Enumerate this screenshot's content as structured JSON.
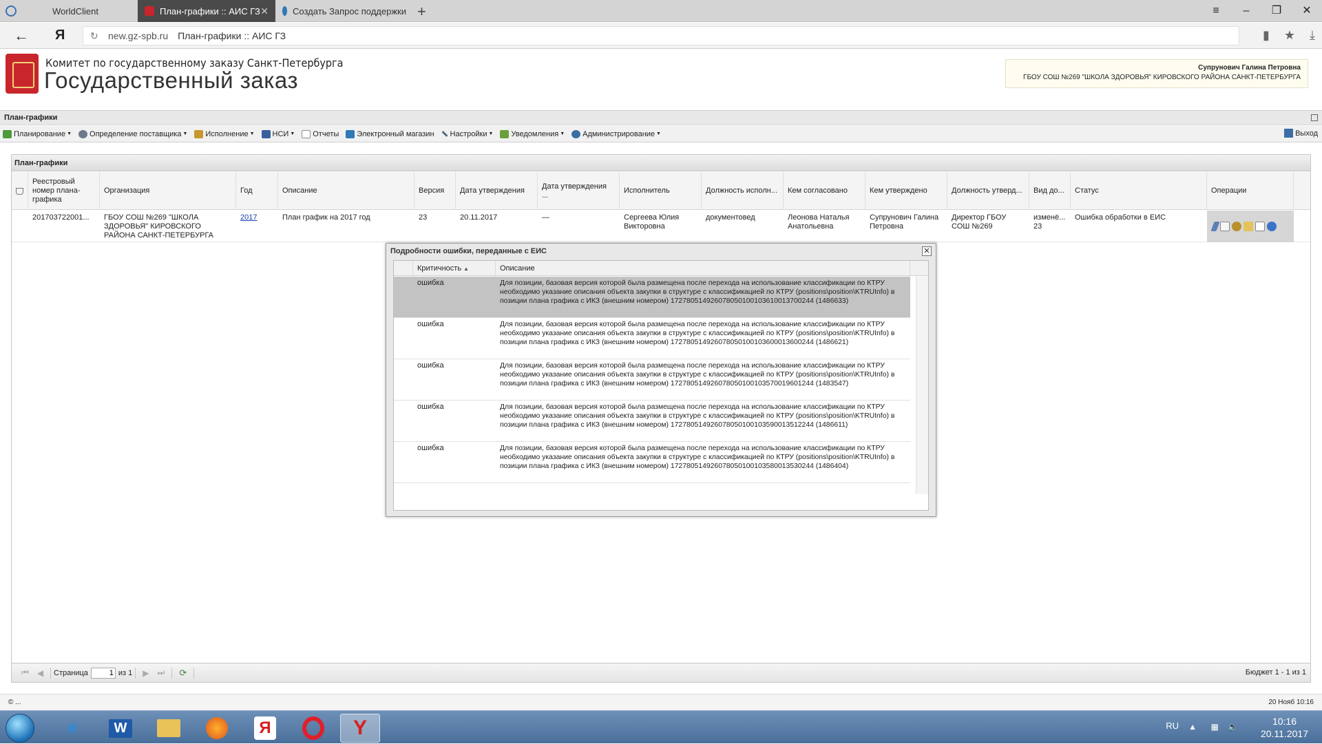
{
  "browser": {
    "tabs": [
      {
        "label": "WorldClient"
      },
      {
        "label": "План-графики :: АИС ГЗ"
      },
      {
        "label": "Создать Запрос поддержки"
      }
    ],
    "address_domain": "new.gz-spb.ru",
    "address_title": "План-графики :: АИС ГЗ"
  },
  "header": {
    "committee": "Комитет по государственному заказу Санкт-Петербурга",
    "title": "Государственный заказ",
    "user_name": "Супрунович Галина Петровна",
    "user_org": "ГБОУ СОШ №269 \"ШКОЛА ЗДОРОВЬЯ\" КИРОВСКОГО РАЙОНА САНКТ-ПЕТЕРБУРГА"
  },
  "module": {
    "title": "План-графики"
  },
  "menu": {
    "items": [
      {
        "label": "Планирование",
        "icon": "planning-icon",
        "color": "#4c9a3a"
      },
      {
        "label": "Определение поставщика",
        "icon": "supplier-icon",
        "color": "#6b7a8a"
      },
      {
        "label": "Исполнение",
        "icon": "execution-icon",
        "color": "#c8972e"
      },
      {
        "label": "НСИ",
        "icon": "reference-icon",
        "color": "#3a5f9e"
      },
      {
        "label": "Отчеты",
        "icon": "reports-icon",
        "color": "#8c8c8c"
      },
      {
        "label": "Электронный магазин",
        "icon": "shop-icon",
        "color": "#2f79b8"
      },
      {
        "label": "Настройки",
        "icon": "settings-icon",
        "color": "#5a6a7a"
      },
      {
        "label": "Уведомления",
        "icon": "notifications-icon",
        "color": "#6aa03a"
      },
      {
        "label": "Администрирование",
        "icon": "admin-icon",
        "color": "#3a6ea5"
      }
    ],
    "logout": "Выход"
  },
  "panel": {
    "title": "План-графики",
    "columns": [
      "Реестровый номер плана-графика",
      "Организация",
      "Год",
      "Описание",
      "Версия",
      "Дата утверждения",
      "Дата утверждения ...",
      "Исполнитель",
      "Должность исполн...",
      "Кем согласовано",
      "Кем утверждено",
      "Должность утверд...",
      "Вид до...",
      "Статус",
      "Операции"
    ],
    "row": {
      "reg_number": "201703722001...",
      "organization": "ГБОУ СОШ №269 \"ШКОЛА ЗДОРОВЬЯ\" КИРОВСКОГО РАЙОНА САНКТ-ПЕТЕРБУРГА",
      "year": "2017",
      "description": "План график на 2017 год",
      "version": "23",
      "approval_date": "20.11.2017",
      "approval_date2": "—",
      "executor": "Сергеева Юлия Викторовна",
      "executor_position": "документовед",
      "agreed_by": "Леонова Наталья Анатольевна",
      "approved_by": "Супрунович Галина Петровна",
      "approver_position": "Директор ГБОУ СОШ №269",
      "doc_type": "изменё... 23",
      "status": "Ошибка обработки в ЕИС"
    },
    "pager": {
      "page_label": "Страница",
      "page_value": "1",
      "of_label": "из 1",
      "summary": "Бюджет 1 - 1 из 1"
    }
  },
  "modal": {
    "title": "Подробности ошибки, переданные с ЕИС",
    "col_severity": "Критичность",
    "col_description": "Описание",
    "rows": [
      {
        "severity": "ошибка",
        "description": "Для позиции, базовая версия которой была размещена после перехода на использование классификации по КТРУ необходимо указание описания объекта закупки в структуре с классификацией по КТРУ (positions\\position\\KTRUInfo) в позиции плана графика с ИКЗ (внешним номером) 172780514926078050100103610013700244 (1486633)"
      },
      {
        "severity": "ошибка",
        "description": "Для позиции, базовая версия которой была размещена после перехода на использование классификации по КТРУ необходимо указание описания объекта закупки в структуре с классификацией по КТРУ (positions\\position\\KTRUInfo) в позиции плана графика с ИКЗ (внешним номером) 172780514926078050100103600013600244 (1486621)"
      },
      {
        "severity": "ошибка",
        "description": "Для позиции, базовая версия которой была размещена после перехода на использование классификации по КТРУ необходимо указание описания объекта закупки в структуре с классификацией по КТРУ (positions\\position\\KTRUInfo) в позиции плана графика с ИКЗ (внешним номером) 172780514926078050100103570019601244 (1483547)"
      },
      {
        "severity": "ошибка",
        "description": "Для позиции, базовая версия которой была размещена после перехода на использование классификации по КТРУ необходимо указание описания объекта закупки в структуре с классификацией по КТРУ (positions\\position\\KTRUInfo) в позиции плана графика с ИКЗ (внешним номером) 172780514926078050100103590013512244 (1486611)"
      },
      {
        "severity": "ошибка",
        "description": "Для позиции, базовая версия которой была размещена после перехода на использование классификации по КТРУ необходимо указание описания объекта закупки в структуре с классификацией по КТРУ (positions\\position\\KTRUInfo) в позиции плана графика с ИКЗ (внешним номером) 172780514926078050100103580013530244 (1486404)"
      }
    ]
  },
  "statusbar": {
    "left": "© ...",
    "right": "20 Нояб 10:16"
  },
  "taskbar": {
    "lang": "RU",
    "time": "10:16",
    "date": "20.11.2017"
  }
}
